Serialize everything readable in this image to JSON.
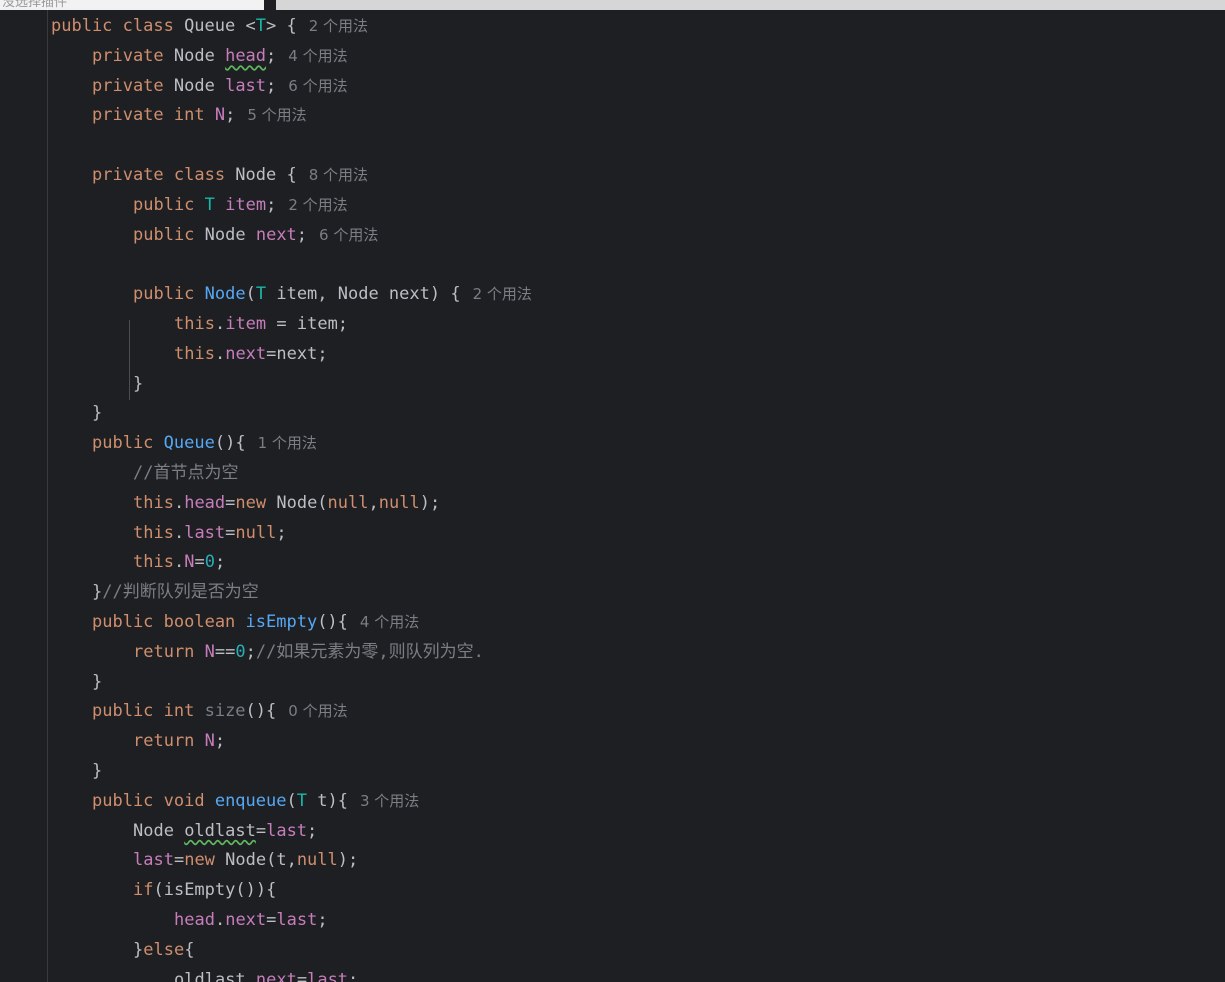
{
  "top_tab": {
    "label": "没选择插件"
  },
  "lines": [
    {
      "indent": 1,
      "tokens": [
        [
          "kw",
          "public class "
        ],
        [
          "cls",
          "Queue "
        ],
        [
          "plain",
          "<"
        ],
        [
          "tp",
          "T"
        ],
        [
          "plain",
          "> {"
        ]
      ],
      "hint": "2 个用法"
    },
    {
      "indent": 2,
      "tokens": [
        [
          "kw",
          "private "
        ],
        [
          "cls",
          "Node "
        ],
        [
          "fld sq",
          "head"
        ],
        [
          "plain",
          ";"
        ]
      ],
      "hint": "4 个用法"
    },
    {
      "indent": 2,
      "tokens": [
        [
          "kw",
          "private "
        ],
        [
          "cls",
          "Node "
        ],
        [
          "fld",
          "last"
        ],
        [
          "plain",
          ";"
        ]
      ],
      "hint": "6 个用法"
    },
    {
      "indent": 2,
      "tokens": [
        [
          "kw",
          "private int "
        ],
        [
          "fld",
          "N"
        ],
        [
          "plain",
          ";"
        ]
      ],
      "hint": "5 个用法"
    },
    {
      "indent": 0,
      "tokens": [],
      "hint": ""
    },
    {
      "indent": 2,
      "tokens": [
        [
          "kw",
          "private class "
        ],
        [
          "cls",
          "Node {"
        ]
      ],
      "hint": "8 个用法"
    },
    {
      "indent": 3,
      "tokens": [
        [
          "kw",
          "public "
        ],
        [
          "tp",
          "T "
        ],
        [
          "fld",
          "item"
        ],
        [
          "plain",
          ";"
        ]
      ],
      "hint": "2 个用法"
    },
    {
      "indent": 3,
      "tokens": [
        [
          "kw",
          "public "
        ],
        [
          "cls",
          "Node "
        ],
        [
          "fld",
          "next"
        ],
        [
          "plain",
          ";"
        ]
      ],
      "hint": "6 个用法"
    },
    {
      "indent": 0,
      "tokens": [],
      "hint": ""
    },
    {
      "indent": 3,
      "tokens": [
        [
          "kw",
          "public "
        ],
        [
          "fn",
          "Node"
        ],
        [
          "plain",
          "("
        ],
        [
          "tp",
          "T "
        ],
        [
          "plain",
          "item, Node next) {"
        ]
      ],
      "hint": "2 个用法"
    },
    {
      "indent": 4,
      "tokens": [
        [
          "kw",
          "this"
        ],
        [
          "plain",
          "."
        ],
        [
          "fld",
          "item"
        ],
        [
          "plain",
          " = item;"
        ]
      ],
      "hint": ""
    },
    {
      "indent": 4,
      "tokens": [
        [
          "kw",
          "this"
        ],
        [
          "plain",
          "."
        ],
        [
          "fld",
          "next"
        ],
        [
          "plain",
          "=next;"
        ]
      ],
      "hint": ""
    },
    {
      "indent": 3,
      "tokens": [
        [
          "plain",
          "}"
        ]
      ],
      "hint": ""
    },
    {
      "indent": 2,
      "tokens": [
        [
          "plain",
          "}"
        ]
      ],
      "hint": ""
    },
    {
      "indent": 2,
      "tokens": [
        [
          "kw",
          "public "
        ],
        [
          "fn",
          "Queue"
        ],
        [
          "plain",
          "(){"
        ]
      ],
      "hint": "1 个用法"
    },
    {
      "indent": 3,
      "tokens": [
        [
          "cmt",
          "//首节点为空"
        ]
      ],
      "hint": ""
    },
    {
      "indent": 3,
      "tokens": [
        [
          "kw",
          "this"
        ],
        [
          "plain",
          "."
        ],
        [
          "fld",
          "head"
        ],
        [
          "plain",
          "="
        ],
        [
          "kw",
          "new "
        ],
        [
          "plain",
          "Node("
        ],
        [
          "kw",
          "null"
        ],
        [
          "plain",
          ","
        ],
        [
          "kw",
          "null"
        ],
        [
          "plain",
          ");"
        ]
      ],
      "hint": ""
    },
    {
      "indent": 3,
      "tokens": [
        [
          "kw",
          "this"
        ],
        [
          "plain",
          "."
        ],
        [
          "fld",
          "last"
        ],
        [
          "plain",
          "="
        ],
        [
          "kw",
          "null"
        ],
        [
          "plain",
          ";"
        ]
      ],
      "hint": ""
    },
    {
      "indent": 3,
      "tokens": [
        [
          "kw",
          "this"
        ],
        [
          "plain",
          "."
        ],
        [
          "fld",
          "N"
        ],
        [
          "plain",
          "="
        ],
        [
          "num",
          "0"
        ],
        [
          "plain",
          ";"
        ]
      ],
      "hint": ""
    },
    {
      "indent": 2,
      "tokens": [
        [
          "plain",
          "}"
        ],
        [
          "cmt",
          "//判断队列是否为空"
        ]
      ],
      "hint": ""
    },
    {
      "indent": 2,
      "tokens": [
        [
          "kw",
          "public boolean "
        ],
        [
          "fn",
          "isEmpty"
        ],
        [
          "plain",
          "(){"
        ]
      ],
      "hint": "4 个用法"
    },
    {
      "indent": 3,
      "tokens": [
        [
          "kw",
          "return "
        ],
        [
          "fld",
          "N"
        ],
        [
          "plain",
          "=="
        ],
        [
          "num",
          "0"
        ],
        [
          "plain",
          ";"
        ],
        [
          "cmt",
          "//如果元素为零,则队列为空."
        ]
      ],
      "hint": ""
    },
    {
      "indent": 2,
      "tokens": [
        [
          "plain",
          "}"
        ]
      ],
      "hint": ""
    },
    {
      "indent": 2,
      "tokens": [
        [
          "kw",
          "public int "
        ],
        [
          "cmt",
          "size"
        ],
        [
          "plain",
          "(){"
        ]
      ],
      "hint": "0 个用法"
    },
    {
      "indent": 3,
      "tokens": [
        [
          "kw",
          "return "
        ],
        [
          "fld",
          "N"
        ],
        [
          "plain",
          ";"
        ]
      ],
      "hint": ""
    },
    {
      "indent": 2,
      "tokens": [
        [
          "plain",
          "}"
        ]
      ],
      "hint": ""
    },
    {
      "indent": 2,
      "tokens": [
        [
          "kw",
          "public void "
        ],
        [
          "fn",
          "enqueue"
        ],
        [
          "plain",
          "("
        ],
        [
          "tp",
          "T "
        ],
        [
          "plain",
          "t){"
        ]
      ],
      "hint": "3 个用法"
    },
    {
      "indent": 3,
      "tokens": [
        [
          "cls",
          "Node "
        ],
        [
          "plain sq",
          "oldlast"
        ],
        [
          "plain",
          "="
        ],
        [
          "fld",
          "last"
        ],
        [
          "plain",
          ";"
        ]
      ],
      "hint": ""
    },
    {
      "indent": 3,
      "tokens": [
        [
          "fld",
          "last"
        ],
        [
          "plain",
          "="
        ],
        [
          "kw",
          "new "
        ],
        [
          "plain",
          "Node(t,"
        ],
        [
          "kw",
          "null"
        ],
        [
          "plain",
          ");"
        ]
      ],
      "hint": ""
    },
    {
      "indent": 3,
      "tokens": [
        [
          "kw",
          "if"
        ],
        [
          "plain",
          "(isEmpty()){"
        ]
      ],
      "hint": ""
    },
    {
      "indent": 4,
      "tokens": [
        [
          "fld",
          "head"
        ],
        [
          "plain",
          "."
        ],
        [
          "fld",
          "next"
        ],
        [
          "plain",
          "="
        ],
        [
          "fld",
          "last"
        ],
        [
          "plain",
          ";"
        ]
      ],
      "hint": ""
    },
    {
      "indent": 3,
      "tokens": [
        [
          "plain",
          "}"
        ],
        [
          "kw",
          "else"
        ],
        [
          "plain",
          "{"
        ]
      ],
      "hint": ""
    },
    {
      "indent": 4,
      "tokens": [
        [
          "plain",
          "oldlast."
        ],
        [
          "fld",
          "next"
        ],
        [
          "plain",
          "="
        ],
        [
          "fld",
          "last"
        ],
        [
          "plain",
          ";"
        ]
      ],
      "hint": ""
    }
  ]
}
